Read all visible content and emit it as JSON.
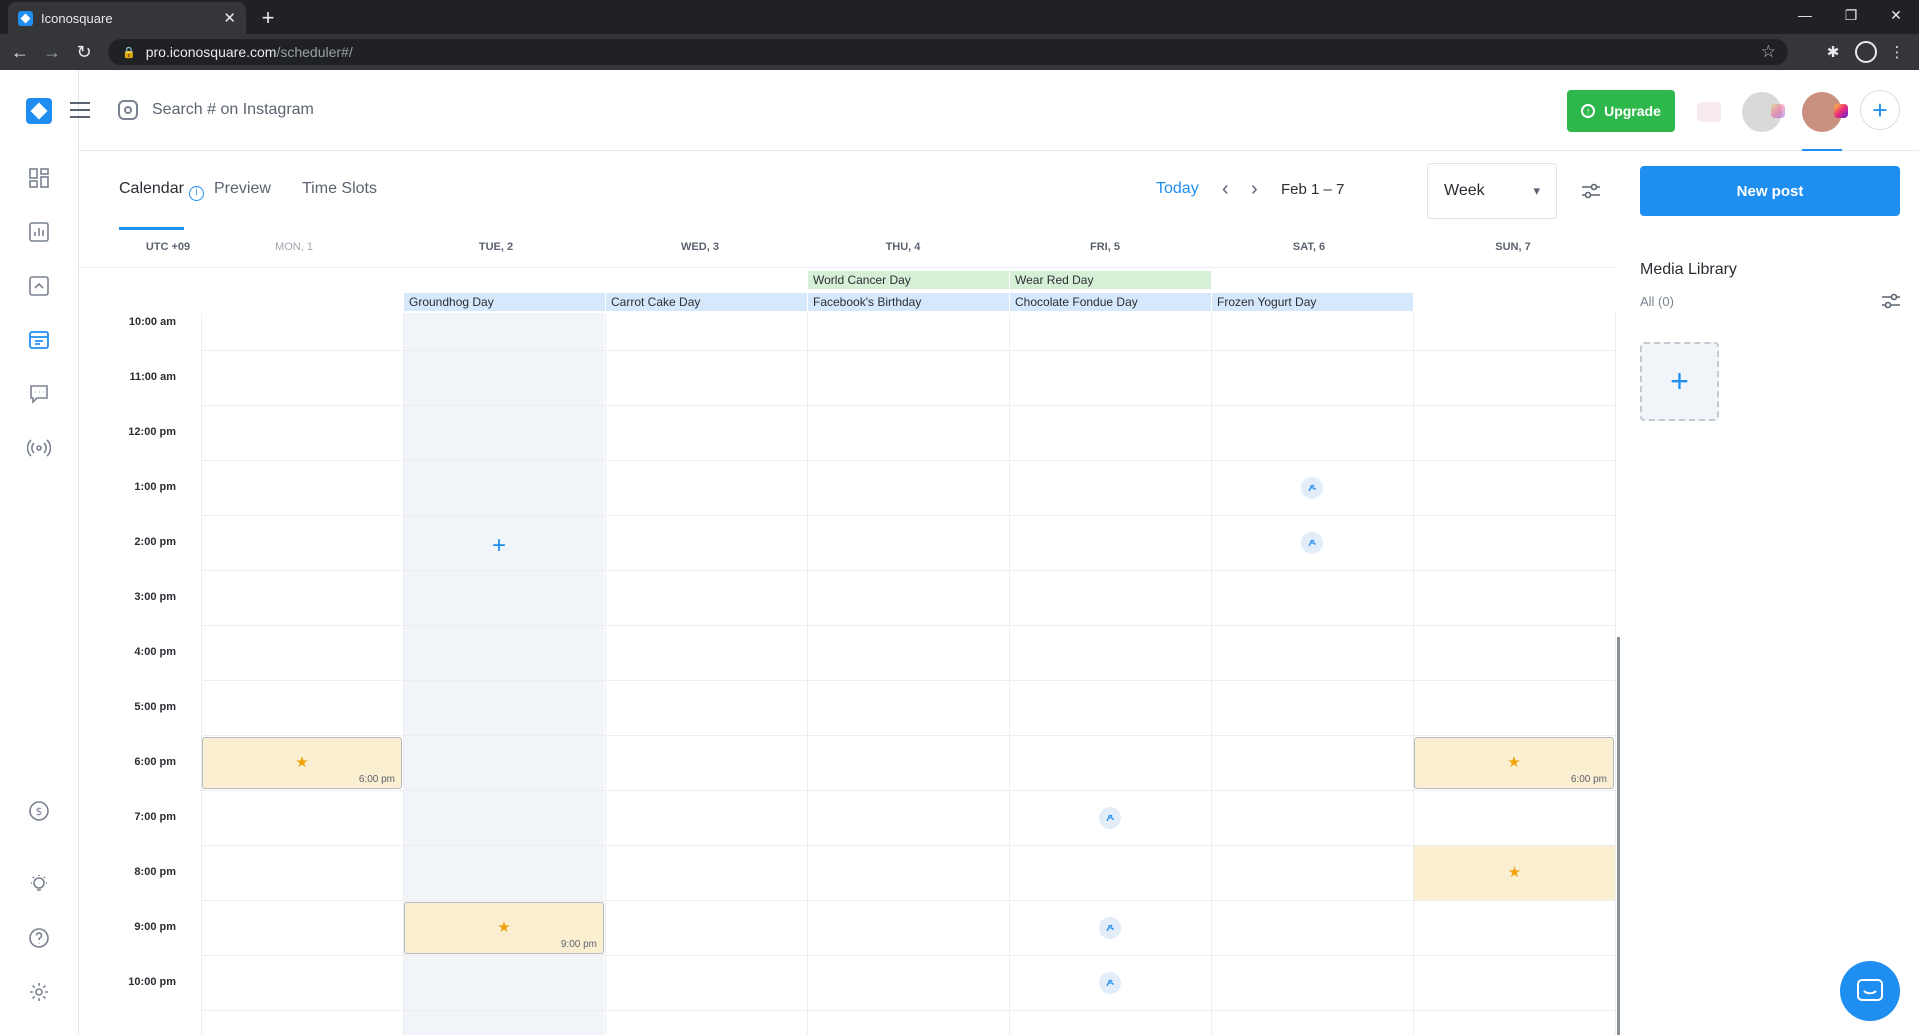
{
  "browser": {
    "tab_title": "Iconosquare",
    "url_host": "pro.iconosquare.com",
    "url_path": "/scheduler#/",
    "new_tab_symbol": "+",
    "close_tab_symbol": "✕"
  },
  "header": {
    "search_placeholder": "Search # on Instagram",
    "upgrade_label": "Upgrade",
    "add_symbol": "+"
  },
  "toolbar": {
    "tabs": [
      "Calendar",
      "Preview",
      "Time Slots"
    ],
    "today_label": "Today",
    "date_range": "Feb 1 – 7",
    "view": "Week",
    "new_post_label": "New post"
  },
  "calendar": {
    "timezone": "UTC +09",
    "days": [
      "MON, 1",
      "TUE, 2",
      "WED, 3",
      "THU, 4",
      "FRI, 5",
      "SAT, 6",
      "SUN, 7"
    ],
    "holidays_row1": [
      {
        "day": 3,
        "label": "World Cancer Day",
        "color": "green"
      },
      {
        "day": 4,
        "label": "Wear Red Day",
        "color": "green"
      }
    ],
    "holidays_row2": [
      {
        "day": 1,
        "label": "Groundhog Day"
      },
      {
        "day": 2,
        "label": "Carrot Cake Day"
      },
      {
        "day": 3,
        "label": "Facebook's Birthday"
      },
      {
        "day": 4,
        "label": "Chocolate Fondue Day"
      },
      {
        "day": 5,
        "label": "Frozen Yogurt Day"
      }
    ],
    "hours": [
      "10:00 am",
      "11:00 am",
      "12:00 pm",
      "1:00 pm",
      "2:00 pm",
      "3:00 pm",
      "4:00 pm",
      "5:00 pm",
      "6:00 pm",
      "7:00 pm",
      "8:00 pm",
      "9:00 pm",
      "10:00 pm"
    ],
    "posts": [
      {
        "day": 0,
        "hour": 8,
        "time": "6:00 pm"
      },
      {
        "day": 6,
        "hour": 8,
        "time": "6:00 pm"
      },
      {
        "day": 6,
        "hour": 10,
        "time": ""
      },
      {
        "day": 1,
        "hour": 11,
        "time": "9:00 pm"
      }
    ],
    "time_slots": [
      {
        "day": 5,
        "hour": 3
      },
      {
        "day": 5,
        "hour": 4
      },
      {
        "day": 4,
        "hour": 9
      },
      {
        "day": 4,
        "hour": 11
      },
      {
        "day": 4,
        "hour": 12
      }
    ]
  },
  "media_library": {
    "title": "Media Library",
    "count_label": "All (0)"
  },
  "colors": {
    "accent": "#1f8ef1",
    "upgrade": "#2eb84b",
    "post_bg": "#fbefd1",
    "star": "#f2a20c"
  },
  "icons": {
    "rail": [
      "dashboard-icon",
      "analytics-icon",
      "media-icon",
      "scheduler-icon",
      "messages-icon",
      "listening-icon",
      "billing-icon",
      "ideas-icon",
      "help-icon",
      "settings-icon"
    ]
  }
}
